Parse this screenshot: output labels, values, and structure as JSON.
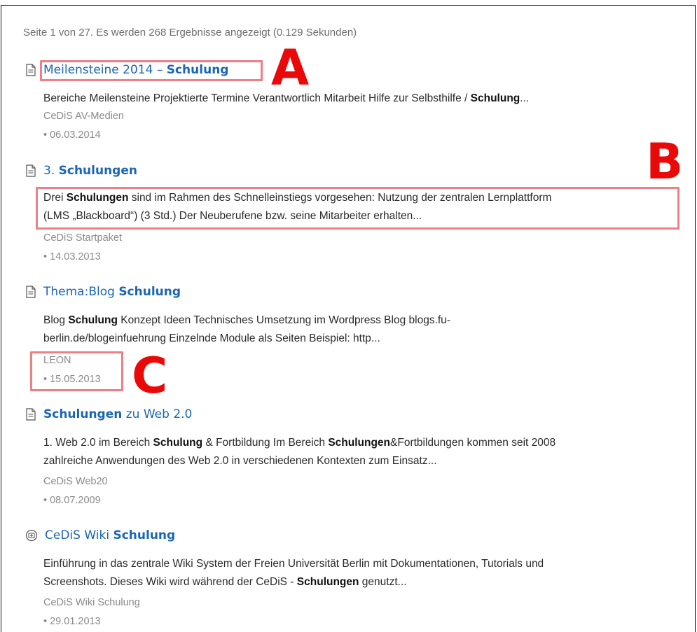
{
  "summary": "Seite 1 von 27. Es werden 268 Ergebnisse angezeigt (0.129 Sekunden)",
  "results": [
    {
      "icon": "document-icon",
      "title": [
        "Meilensteine 2014 – ",
        "Schulung"
      ],
      "snippet": [
        "Bereiche Meilensteine Projektierte Termine Verantwortlich Mitarbeit Hilfe zur Selbsthilfe / ",
        "Schulung",
        "..."
      ],
      "source": "CeDiS AV-Medien",
      "date": "• 06.03.2014"
    },
    {
      "icon": "document-icon",
      "title": [
        "3. ",
        "Schulungen"
      ],
      "snippet_line1": [
        "Drei ",
        "Schulungen",
        " sind im Rahmen des Schnelleinstiegs vorgesehen: Nutzung der zentralen Lernplattform"
      ],
      "snippet_line2": "(LMS „Blackboard“) (3 Std.) Der Neuberufene bzw. seine Mitarbeiter erhalten...",
      "source": "CeDiS Startpaket",
      "date": "• 14.03.2013"
    },
    {
      "icon": "document-icon",
      "title": [
        "Thema:Blog ",
        "Schulung"
      ],
      "snippet_line1": [
        "Blog ",
        "Schulung",
        " Konzept Ideen Technisches Umsetzung im Wordpress Blog blogs.fu-"
      ],
      "snippet_line2": "berlin.de/blogeinfuehrung Einzelnde Module als Seiten Beispiel: http...",
      "source": "LEON",
      "date": "• 15.05.2013"
    },
    {
      "icon": "document-icon",
      "title": [
        "Schulungen",
        " zu Web 2.0"
      ],
      "snippet_line1": [
        "1. Web 2.0 im Bereich ",
        "Schulung",
        " & Fortbildung Im Bereich ",
        "Schulungen",
        "&Fortbildungen kommen seit 2008"
      ],
      "snippet_line2": "zahlreiche Anwendungen des Web 2.0 in verschiedenen Kontexten zum Einsatz...",
      "source": "CeDiS Web20",
      "date": "• 08.07.2009"
    },
    {
      "icon": "wiki-icon",
      "title": [
        "CeDiS Wiki ",
        "Schulung"
      ],
      "snippet_line1": "Einführung in das zentrale Wiki System der Freien Universität Berlin mit Dokumentationen, Tutorials und",
      "snippet_line2": [
        "Screenshots. Dieses Wiki wird während der CeDiS - ",
        "Schulungen",
        " genutzt..."
      ],
      "source": "CeDiS Wiki Schulung",
      "date": "• 29.01.2013"
    }
  ],
  "markers": {
    "a": "A",
    "b": "B",
    "c": "C"
  },
  "colors": {
    "link": "#1a66b3",
    "highlight": "#ef7f86",
    "marker": "#ea0909"
  }
}
